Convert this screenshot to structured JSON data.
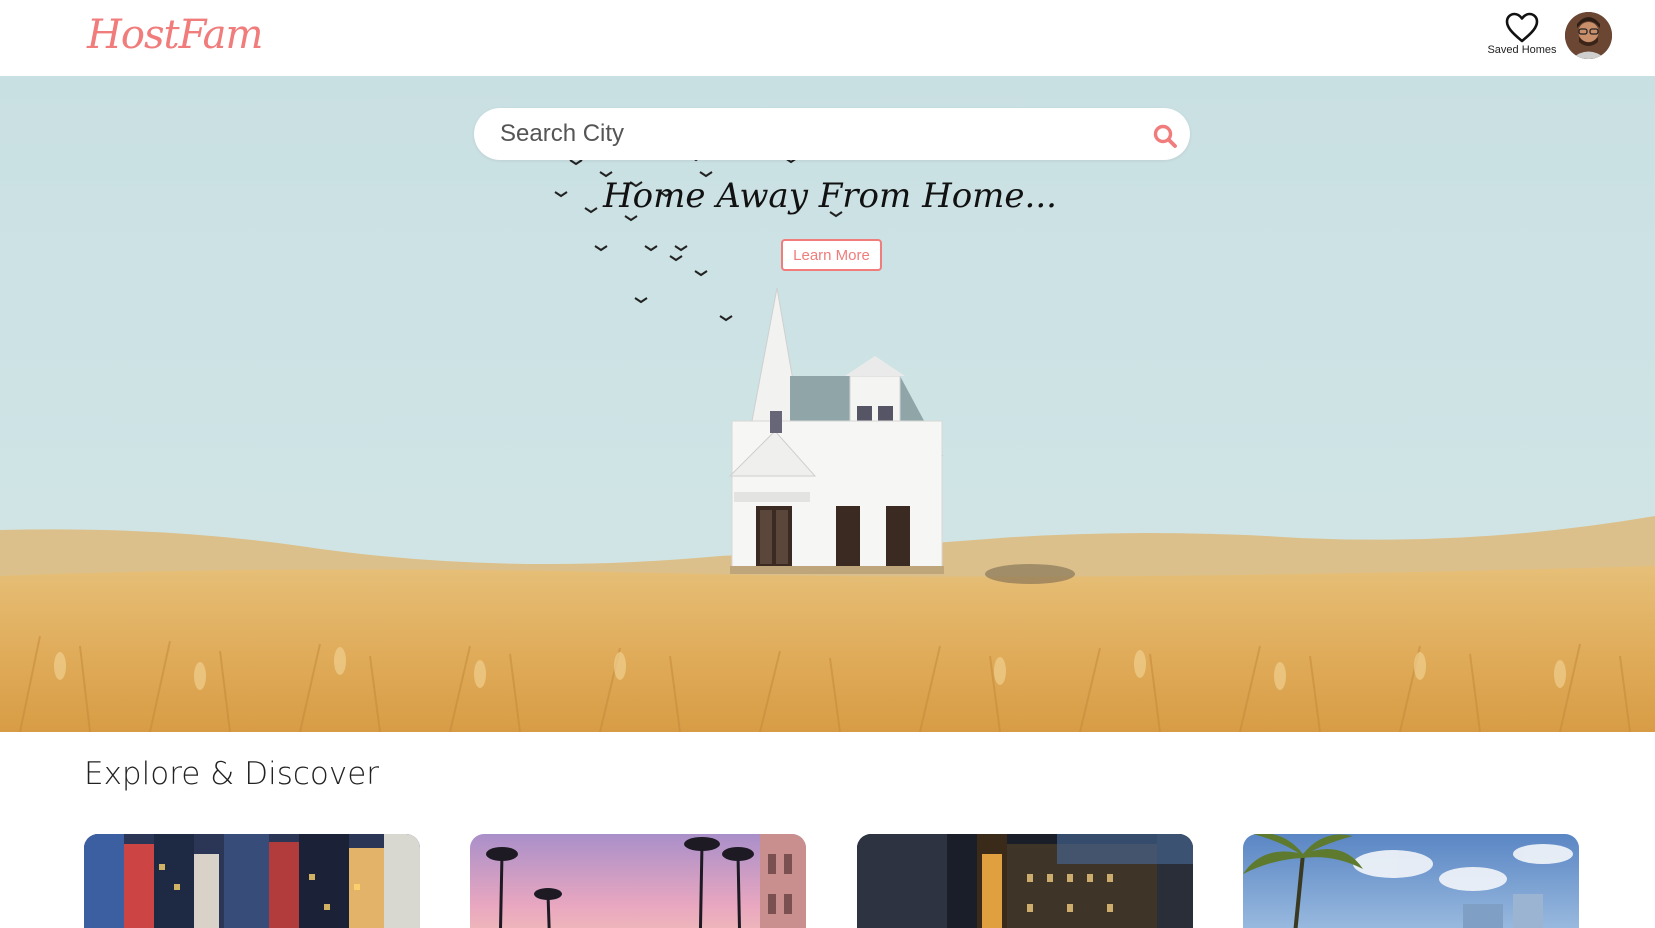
{
  "header": {
    "logo": "HostFam",
    "saved_label": "Saved Homes",
    "saved_icon": "heart-icon",
    "avatar_icon": "user-avatar"
  },
  "hero": {
    "search_placeholder": "Search City",
    "search_icon": "search-icon",
    "tagline": "Home Away From Home...",
    "learn_more": "Learn More"
  },
  "explore": {
    "title": "Explore & Discover",
    "cards": [
      {
        "image": "city-times-square"
      },
      {
        "image": "palm-sunset-street"
      },
      {
        "image": "theater-night-city"
      },
      {
        "image": "palm-beach-skyline"
      }
    ]
  },
  "colors": {
    "accent": "#f07c7c",
    "sky": "#cfe3e6",
    "field": "#e2b466"
  }
}
